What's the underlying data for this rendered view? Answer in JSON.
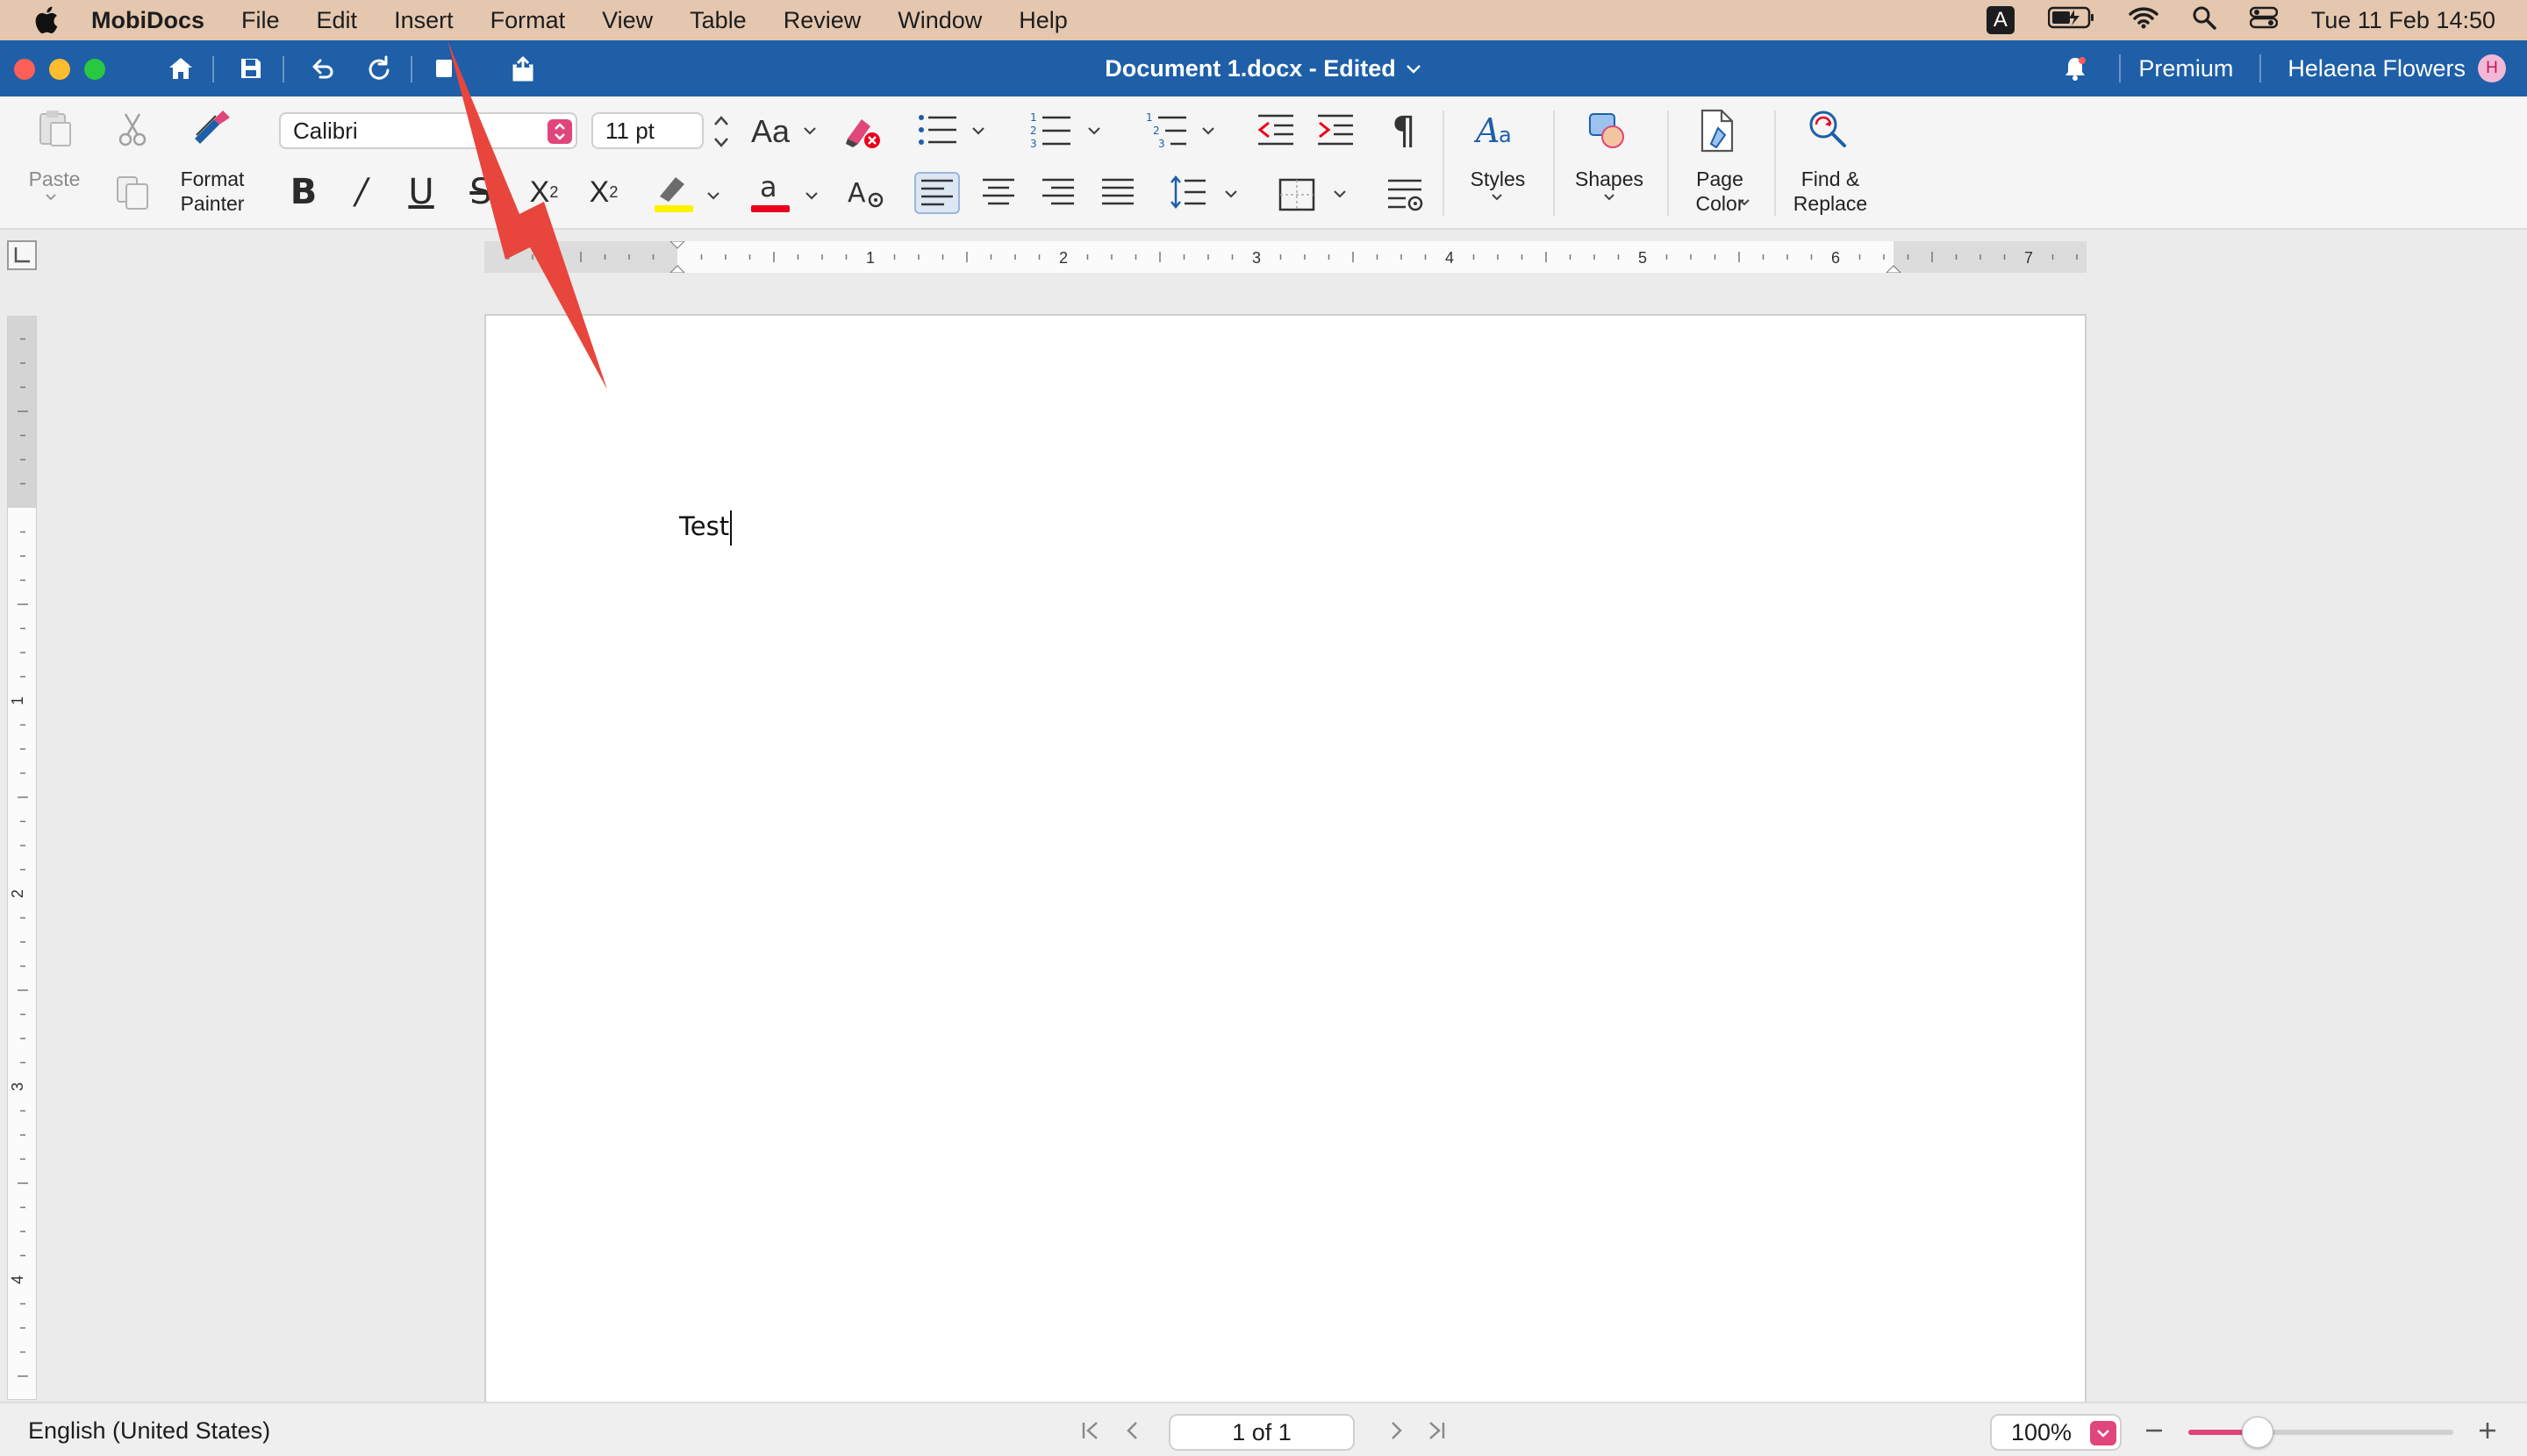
{
  "menubar": {
    "app_name": "MobiDocs",
    "items": [
      "File",
      "Edit",
      "Insert",
      "Format",
      "View",
      "Table",
      "Review",
      "Window",
      "Help"
    ],
    "input_source": "A",
    "datetime": "Tue 11 Feb  14:50"
  },
  "titlebar": {
    "document_title": "Document 1.docx - Edited",
    "premium_label": "Premium",
    "user_name": "Helaena Flowers",
    "avatar_initial": "H"
  },
  "toolbar": {
    "paste_label": "Paste",
    "format_painter_line1": "Format",
    "format_painter_line2": "Painter",
    "font_family": "Calibri",
    "font_size": "11 pt",
    "change_case_label": "Aa",
    "styles_label": "Styles",
    "shapes_label": "Shapes",
    "page_color_line1": "Page",
    "page_color_line2": "Color",
    "find_replace_line1": "Find &",
    "find_replace_line2": "Replace",
    "highlight_color": "#fff200",
    "font_color": "#e8001c"
  },
  "ruler": {
    "h_numbers": [
      "1",
      "2",
      "3",
      "4",
      "5",
      "6",
      "7"
    ],
    "v_numbers": [
      "1",
      "2",
      "3",
      "4"
    ]
  },
  "document": {
    "text": "Test"
  },
  "statusbar": {
    "language": "English (United States)",
    "page_indicator": "1 of 1",
    "zoom": "100%",
    "zoom_level_fraction": 0.26
  },
  "colors": {
    "accent_blue": "#1e5fa8",
    "accent_pink": "#e0457b",
    "menubar_bg": "#e4c7ae",
    "annotation_arrow": "#e8453c"
  }
}
